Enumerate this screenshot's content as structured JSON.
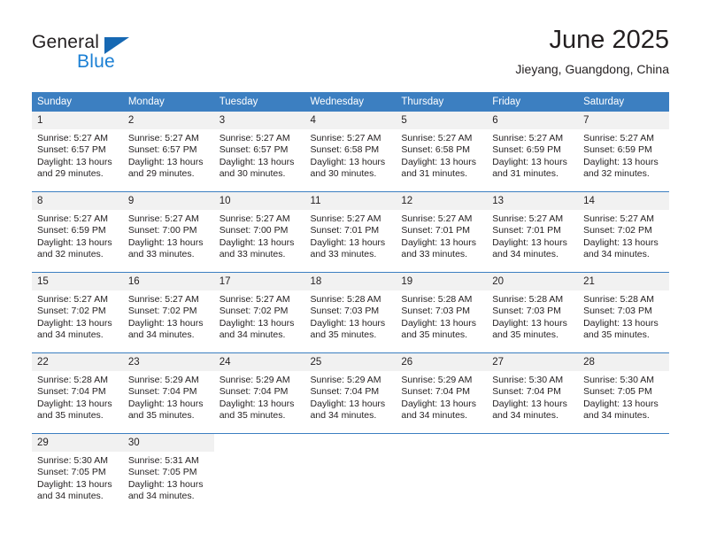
{
  "brand": {
    "name_part1": "General",
    "name_part2": "Blue",
    "triangle_color": "#1668b3",
    "blue_text_color": "#1a7fd4"
  },
  "header": {
    "title": "June 2025",
    "subtitle": "Jieyang, Guangdong, China"
  },
  "theme": {
    "header_row_bg": "#3c7fc1",
    "header_row_text": "#ffffff",
    "daynum_bg": "#f1f1f1",
    "row_divider": "#3c7fc1",
    "body_text": "#231f20"
  },
  "weekday_headers": [
    "Sunday",
    "Monday",
    "Tuesday",
    "Wednesday",
    "Thursday",
    "Friday",
    "Saturday"
  ],
  "weeks": [
    [
      {
        "day": "1",
        "sunrise": "Sunrise: 5:27 AM",
        "sunset": "Sunset: 6:57 PM",
        "daylight": "Daylight: 13 hours and 29 minutes."
      },
      {
        "day": "2",
        "sunrise": "Sunrise: 5:27 AM",
        "sunset": "Sunset: 6:57 PM",
        "daylight": "Daylight: 13 hours and 29 minutes."
      },
      {
        "day": "3",
        "sunrise": "Sunrise: 5:27 AM",
        "sunset": "Sunset: 6:57 PM",
        "daylight": "Daylight: 13 hours and 30 minutes."
      },
      {
        "day": "4",
        "sunrise": "Sunrise: 5:27 AM",
        "sunset": "Sunset: 6:58 PM",
        "daylight": "Daylight: 13 hours and 30 minutes."
      },
      {
        "day": "5",
        "sunrise": "Sunrise: 5:27 AM",
        "sunset": "Sunset: 6:58 PM",
        "daylight": "Daylight: 13 hours and 31 minutes."
      },
      {
        "day": "6",
        "sunrise": "Sunrise: 5:27 AM",
        "sunset": "Sunset: 6:59 PM",
        "daylight": "Daylight: 13 hours and 31 minutes."
      },
      {
        "day": "7",
        "sunrise": "Sunrise: 5:27 AM",
        "sunset": "Sunset: 6:59 PM",
        "daylight": "Daylight: 13 hours and 32 minutes."
      }
    ],
    [
      {
        "day": "8",
        "sunrise": "Sunrise: 5:27 AM",
        "sunset": "Sunset: 6:59 PM",
        "daylight": "Daylight: 13 hours and 32 minutes."
      },
      {
        "day": "9",
        "sunrise": "Sunrise: 5:27 AM",
        "sunset": "Sunset: 7:00 PM",
        "daylight": "Daylight: 13 hours and 33 minutes."
      },
      {
        "day": "10",
        "sunrise": "Sunrise: 5:27 AM",
        "sunset": "Sunset: 7:00 PM",
        "daylight": "Daylight: 13 hours and 33 minutes."
      },
      {
        "day": "11",
        "sunrise": "Sunrise: 5:27 AM",
        "sunset": "Sunset: 7:01 PM",
        "daylight": "Daylight: 13 hours and 33 minutes."
      },
      {
        "day": "12",
        "sunrise": "Sunrise: 5:27 AM",
        "sunset": "Sunset: 7:01 PM",
        "daylight": "Daylight: 13 hours and 33 minutes."
      },
      {
        "day": "13",
        "sunrise": "Sunrise: 5:27 AM",
        "sunset": "Sunset: 7:01 PM",
        "daylight": "Daylight: 13 hours and 34 minutes."
      },
      {
        "day": "14",
        "sunrise": "Sunrise: 5:27 AM",
        "sunset": "Sunset: 7:02 PM",
        "daylight": "Daylight: 13 hours and 34 minutes."
      }
    ],
    [
      {
        "day": "15",
        "sunrise": "Sunrise: 5:27 AM",
        "sunset": "Sunset: 7:02 PM",
        "daylight": "Daylight: 13 hours and 34 minutes."
      },
      {
        "day": "16",
        "sunrise": "Sunrise: 5:27 AM",
        "sunset": "Sunset: 7:02 PM",
        "daylight": "Daylight: 13 hours and 34 minutes."
      },
      {
        "day": "17",
        "sunrise": "Sunrise: 5:27 AM",
        "sunset": "Sunset: 7:02 PM",
        "daylight": "Daylight: 13 hours and 34 minutes."
      },
      {
        "day": "18",
        "sunrise": "Sunrise: 5:28 AM",
        "sunset": "Sunset: 7:03 PM",
        "daylight": "Daylight: 13 hours and 35 minutes."
      },
      {
        "day": "19",
        "sunrise": "Sunrise: 5:28 AM",
        "sunset": "Sunset: 7:03 PM",
        "daylight": "Daylight: 13 hours and 35 minutes."
      },
      {
        "day": "20",
        "sunrise": "Sunrise: 5:28 AM",
        "sunset": "Sunset: 7:03 PM",
        "daylight": "Daylight: 13 hours and 35 minutes."
      },
      {
        "day": "21",
        "sunrise": "Sunrise: 5:28 AM",
        "sunset": "Sunset: 7:03 PM",
        "daylight": "Daylight: 13 hours and 35 minutes."
      }
    ],
    [
      {
        "day": "22",
        "sunrise": "Sunrise: 5:28 AM",
        "sunset": "Sunset: 7:04 PM",
        "daylight": "Daylight: 13 hours and 35 minutes."
      },
      {
        "day": "23",
        "sunrise": "Sunrise: 5:29 AM",
        "sunset": "Sunset: 7:04 PM",
        "daylight": "Daylight: 13 hours and 35 minutes."
      },
      {
        "day": "24",
        "sunrise": "Sunrise: 5:29 AM",
        "sunset": "Sunset: 7:04 PM",
        "daylight": "Daylight: 13 hours and 35 minutes."
      },
      {
        "day": "25",
        "sunrise": "Sunrise: 5:29 AM",
        "sunset": "Sunset: 7:04 PM",
        "daylight": "Daylight: 13 hours and 34 minutes."
      },
      {
        "day": "26",
        "sunrise": "Sunrise: 5:29 AM",
        "sunset": "Sunset: 7:04 PM",
        "daylight": "Daylight: 13 hours and 34 minutes."
      },
      {
        "day": "27",
        "sunrise": "Sunrise: 5:30 AM",
        "sunset": "Sunset: 7:04 PM",
        "daylight": "Daylight: 13 hours and 34 minutes."
      },
      {
        "day": "28",
        "sunrise": "Sunrise: 5:30 AM",
        "sunset": "Sunset: 7:05 PM",
        "daylight": "Daylight: 13 hours and 34 minutes."
      }
    ],
    [
      {
        "day": "29",
        "sunrise": "Sunrise: 5:30 AM",
        "sunset": "Sunset: 7:05 PM",
        "daylight": "Daylight: 13 hours and 34 minutes."
      },
      {
        "day": "30",
        "sunrise": "Sunrise: 5:31 AM",
        "sunset": "Sunset: 7:05 PM",
        "daylight": "Daylight: 13 hours and 34 minutes."
      },
      {
        "day": "",
        "sunrise": "",
        "sunset": "",
        "daylight": ""
      },
      {
        "day": "",
        "sunrise": "",
        "sunset": "",
        "daylight": ""
      },
      {
        "day": "",
        "sunrise": "",
        "sunset": "",
        "daylight": ""
      },
      {
        "day": "",
        "sunrise": "",
        "sunset": "",
        "daylight": ""
      },
      {
        "day": "",
        "sunrise": "",
        "sunset": "",
        "daylight": ""
      }
    ]
  ]
}
